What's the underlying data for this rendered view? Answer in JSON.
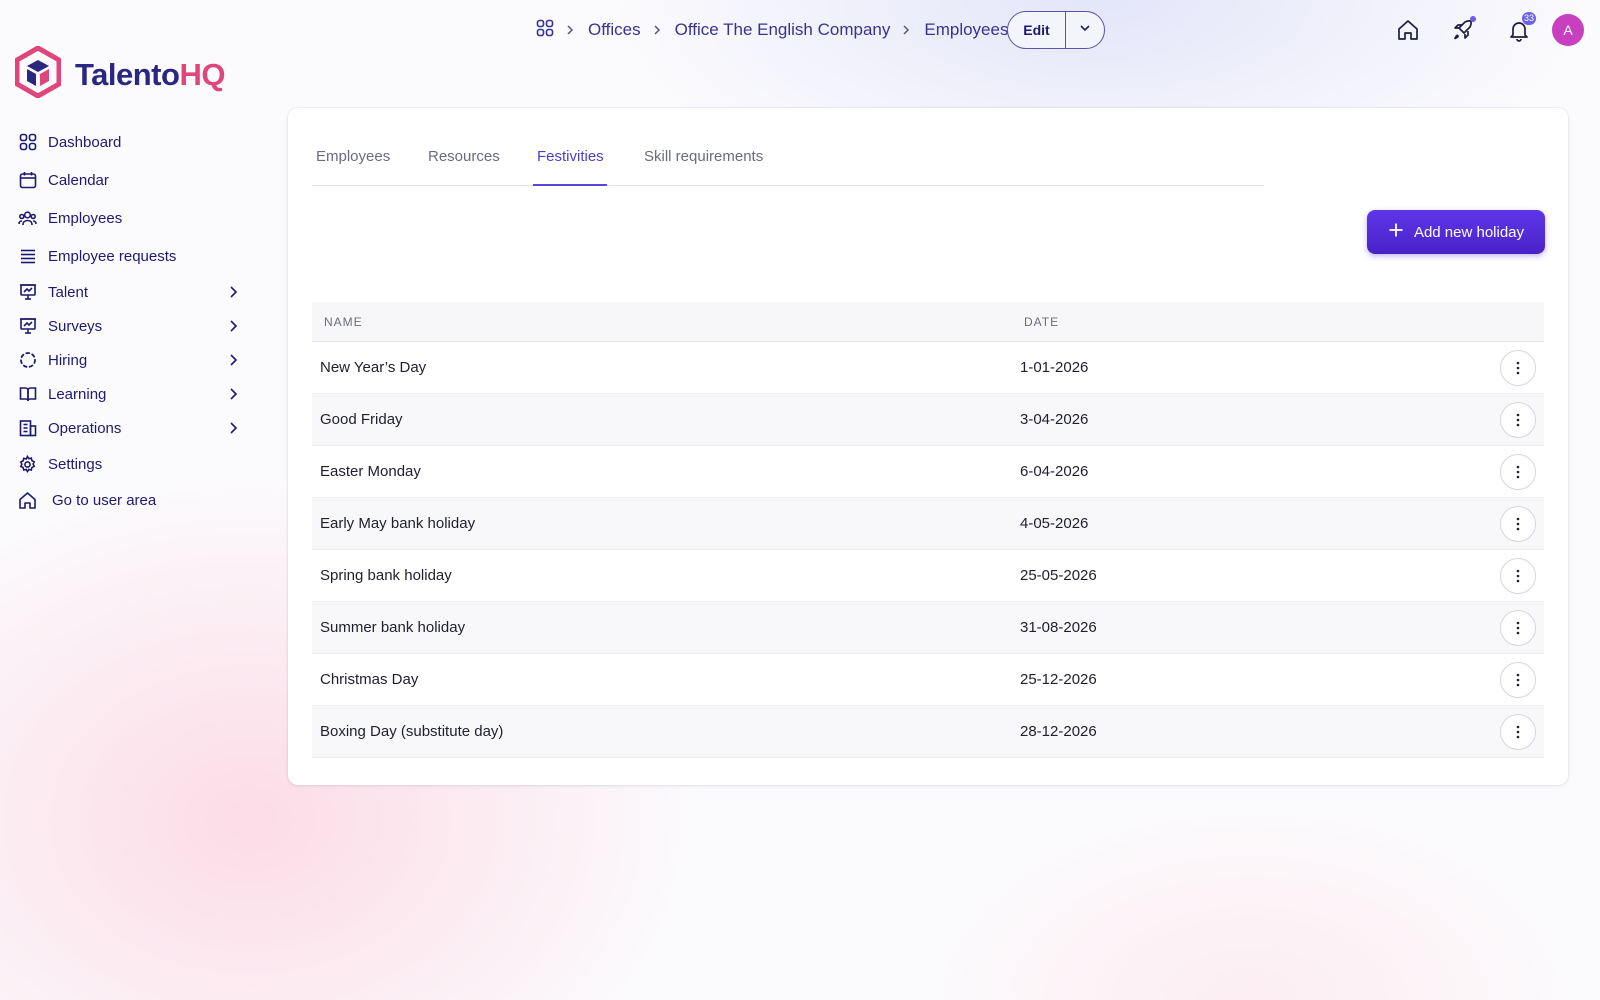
{
  "brand": {
    "name_part1": "Talento",
    "name_part2": "HQ",
    "colors": {
      "primary": "#2b2680",
      "accent": "#e0457b"
    }
  },
  "sidebar": {
    "items": [
      {
        "label": "Dashboard",
        "icon": "grid-icon",
        "expandable": false
      },
      {
        "label": "Calendar",
        "icon": "calendar-icon",
        "expandable": false
      },
      {
        "label": "Employees",
        "icon": "users-icon",
        "expandable": false
      },
      {
        "label": "Employee requests",
        "icon": "list-icon",
        "expandable": false
      },
      {
        "label": "Talent",
        "icon": "presentation-icon",
        "expandable": true
      },
      {
        "label": "Surveys",
        "icon": "presentation-icon",
        "expandable": true
      },
      {
        "label": "Hiring",
        "icon": "dashed-circle-icon",
        "expandable": true
      },
      {
        "label": "Learning",
        "icon": "book-icon",
        "expandable": true
      },
      {
        "label": "Operations",
        "icon": "building-icon",
        "expandable": true
      },
      {
        "label": "Settings",
        "icon": "gear-icon",
        "expandable": false
      },
      {
        "label": "Go to user area",
        "icon": "home-icon",
        "expandable": false
      }
    ]
  },
  "breadcrumb": {
    "items": [
      "Offices",
      "Office The English Company",
      "Employees"
    ],
    "edit_label": "Edit"
  },
  "header": {
    "notification_count": "33",
    "avatar_initial": "A"
  },
  "tabs": {
    "items": [
      "Employees",
      "Resources",
      "Festivities",
      "Skill requirements"
    ],
    "active": "Festivities"
  },
  "actions": {
    "add_label": "Add new holiday"
  },
  "table": {
    "headers": {
      "name": "NAME",
      "date": "DATE"
    },
    "rows": [
      {
        "name": "New Year’s Day",
        "date": "1-01-2026"
      },
      {
        "name": "Good Friday",
        "date": "3-04-2026"
      },
      {
        "name": "Easter Monday",
        "date": "6-04-2026"
      },
      {
        "name": "Early May bank holiday",
        "date": "4-05-2026"
      },
      {
        "name": "Spring bank holiday",
        "date": "25-05-2026"
      },
      {
        "name": "Summer bank holiday",
        "date": "31-08-2026"
      },
      {
        "name": "Christmas Day",
        "date": "25-12-2026"
      },
      {
        "name": "Boxing Day (substitute day)",
        "date": "28-12-2026"
      }
    ]
  }
}
